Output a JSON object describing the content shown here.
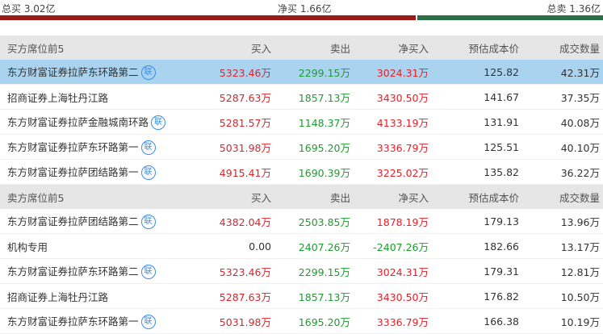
{
  "summary": {
    "total_buy": "总买 3.02亿",
    "net_buy": "净买 1.66亿",
    "total_sell": "总卖 1.36亿",
    "buy_share": 0.69
  },
  "headers": {
    "buy_section": "买方席位前5",
    "sell_section": "卖方席位前5",
    "buy": "买入",
    "sell": "卖出",
    "net": "净买入",
    "cost": "预估成本价",
    "volume": "成交数量"
  },
  "badge_text": "联",
  "buy_rows": [
    {
      "name": "东方财富证券拉萨东环路第二",
      "badge": true,
      "buy": "5323.46万",
      "sell": "2299.15万",
      "net": "3024.31万",
      "cost": "125.82",
      "volume": "42.31万"
    },
    {
      "name": "招商证券上海牡丹江路",
      "badge": false,
      "buy": "5287.63万",
      "sell": "1857.13万",
      "net": "3430.50万",
      "cost": "141.67",
      "volume": "37.35万"
    },
    {
      "name": "东方财富证券拉萨金融城南环路",
      "badge": true,
      "buy": "5281.57万",
      "sell": "1148.37万",
      "net": "4133.19万",
      "cost": "131.91",
      "volume": "40.08万"
    },
    {
      "name": "东方财富证券拉萨东环路第一",
      "badge": true,
      "buy": "5031.98万",
      "sell": "1695.20万",
      "net": "3336.79万",
      "cost": "125.51",
      "volume": "40.10万"
    },
    {
      "name": "东方财富证券拉萨团结路第一",
      "badge": true,
      "buy": "4915.41万",
      "sell": "1690.39万",
      "net": "3225.02万",
      "cost": "135.82",
      "volume": "36.22万"
    }
  ],
  "sell_rows": [
    {
      "name": "东方财富证券拉萨团结路第二",
      "badge": true,
      "buy": "4382.04万",
      "sell": "2503.85万",
      "net": "1878.19万",
      "cost": "179.13",
      "volume": "13.96万"
    },
    {
      "name": "机构专用",
      "badge": false,
      "buy": "0.00",
      "sell": "2407.26万",
      "net": "-2407.26万",
      "cost": "182.66",
      "volume": "13.17万"
    },
    {
      "name": "东方财富证券拉萨东环路第二",
      "badge": true,
      "buy": "5323.46万",
      "sell": "2299.15万",
      "net": "3024.31万",
      "cost": "179.31",
      "volume": "12.81万"
    },
    {
      "name": "招商证券上海牡丹江路",
      "badge": false,
      "buy": "5287.63万",
      "sell": "1857.13万",
      "net": "3430.50万",
      "cost": "176.82",
      "volume": "10.50万"
    },
    {
      "name": "东方财富证券拉萨东环路第一",
      "badge": true,
      "buy": "5031.98万",
      "sell": "1695.20万",
      "net": "3336.79万",
      "cost": "166.38",
      "volume": "10.19万"
    }
  ],
  "colors": {
    "buy_bar": "#9b1b1b",
    "sell_bar": "#2b6e47",
    "positive": "#e0222a",
    "negative": "#1a9e2c",
    "selected_row": "#a9d3ef",
    "badge": "#3a8ee6"
  }
}
